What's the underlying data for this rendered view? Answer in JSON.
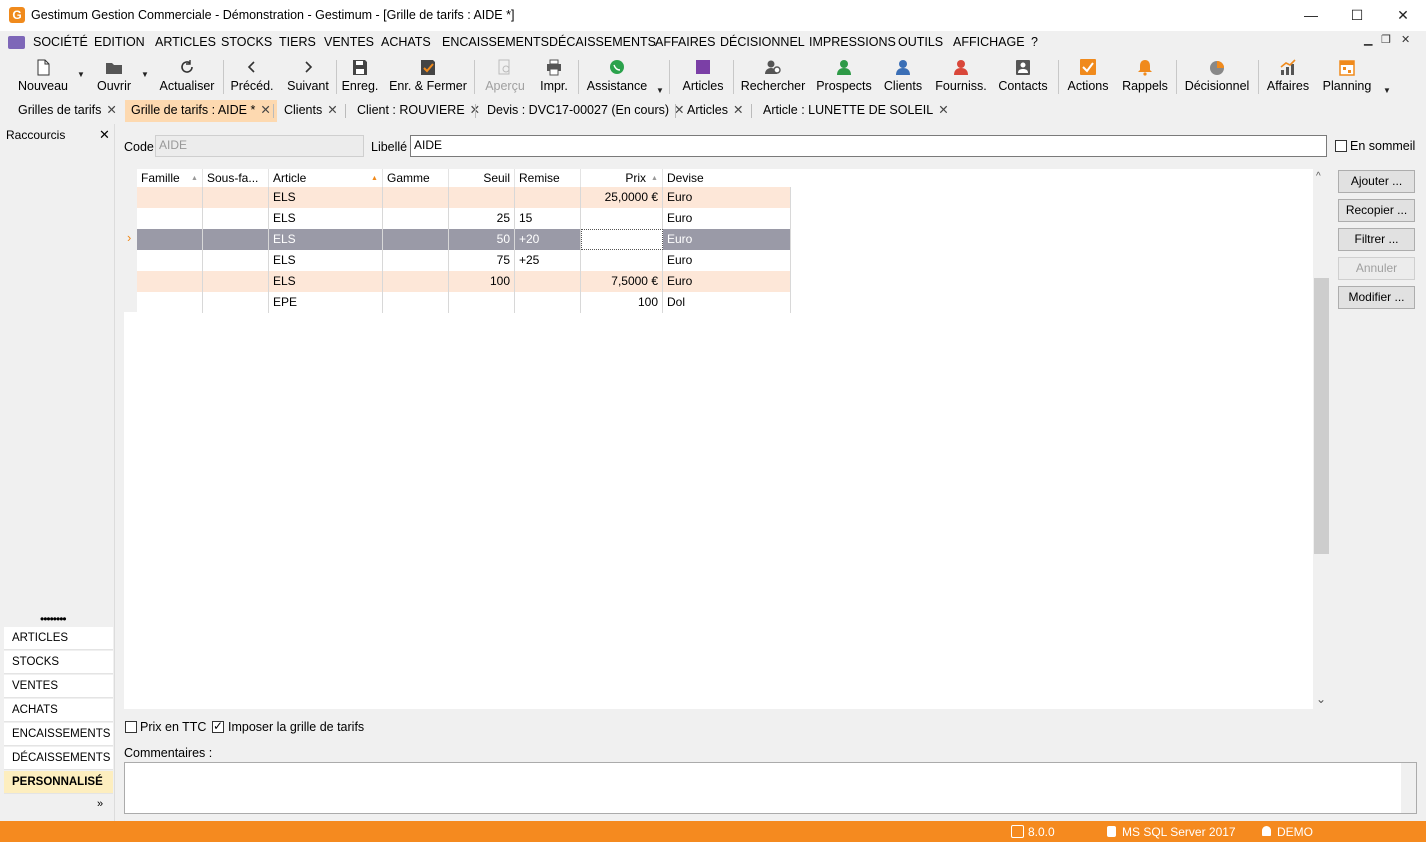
{
  "window": {
    "title": "Gestimum Gestion Commerciale - Démonstration - Gestimum - [Grille de tarifs : AIDE *]",
    "logo_letter": "G",
    "minimize": "—",
    "maximize": "☐",
    "close": "✕"
  },
  "menu": {
    "items": [
      "SOCIÉTÉ",
      "EDITION",
      "ARTICLES",
      "STOCKS",
      "TIERS",
      "VENTES",
      "ACHATS",
      "ENCAISSEMENTS",
      "DÉCAISSEMENTS",
      "AFFAIRES",
      "DÉCISIONNEL",
      "IMPRESSIONS",
      "OUTILS",
      "AFFICHAGE",
      "?"
    ],
    "mdi_minimize": "▁",
    "mdi_restore": "❐",
    "mdi_close": "✕"
  },
  "toolbar": {
    "nouveau": "Nouveau",
    "ouvrir": "Ouvrir",
    "actualiser": "Actualiser",
    "preced": "Précéd.",
    "suivant": "Suivant",
    "enreg": "Enreg.",
    "enr_fermer": "Enr. & Fermer",
    "apercu": "Aperçu",
    "impr": "Impr.",
    "assistance": "Assistance",
    "articles": "Articles",
    "rechercher": "Rechercher",
    "prospects": "Prospects",
    "clients": "Clients",
    "fourniss": "Fourniss.",
    "contacts": "Contacts",
    "actions": "Actions",
    "rappels": "Rappels",
    "decisionnel": "Décisionnel",
    "affaires": "Affaires",
    "planning": "Planning"
  },
  "tabs": [
    {
      "label": "Grilles de tarifs",
      "close": "✕"
    },
    {
      "label": "Grille de tarifs : AIDE *",
      "close": "✕"
    },
    {
      "label": "Clients",
      "close": "✕"
    },
    {
      "label": "Client : ROUVIERE",
      "close": "✕"
    },
    {
      "label": "Devis : DVC17-00027 (En cours)",
      "close": "✕"
    },
    {
      "label": "Articles",
      "close": "✕"
    },
    {
      "label": "Article : LUNETTE DE SOLEIL",
      "close": "✕"
    }
  ],
  "left_panel": {
    "title": "Raccourcis",
    "close": "✕",
    "grip": "••••••••",
    "items": [
      "ARTICLES",
      "STOCKS",
      "VENTES",
      "ACHATS",
      "ENCAISSEMENTS",
      "DÉCAISSEMENTS",
      "PERSONNALISÉ"
    ],
    "selected": "PERSONNALISÉ",
    "more": "»"
  },
  "form": {
    "code_label": "Code",
    "code_value": "AIDE",
    "libelle_label": "Libellé",
    "libelle_value": "AIDE",
    "en_sommeil_label": "En sommeil",
    "en_sommeil_checked": false
  },
  "grid": {
    "columns": [
      "Famille",
      "Sous-fa...",
      "Article",
      "Gamme",
      "Seuil",
      "Remise",
      "Prix",
      "Devise"
    ],
    "rows": [
      {
        "famille": "",
        "sousfa": "",
        "article": "ELS",
        "gamme": "",
        "seuil": "",
        "remise": "",
        "prix": "25,0000 €",
        "devise": "Euro",
        "style": "peach"
      },
      {
        "famille": "",
        "sousfa": "",
        "article": "ELS",
        "gamme": "",
        "seuil": "25",
        "remise": "15",
        "prix": "",
        "devise": "Euro",
        "style": "white"
      },
      {
        "famille": "",
        "sousfa": "",
        "article": "ELS",
        "gamme": "",
        "seuil": "50",
        "remise": "+20",
        "prix": "",
        "devise": "Euro",
        "style": "selected"
      },
      {
        "famille": "",
        "sousfa": "",
        "article": "ELS",
        "gamme": "",
        "seuil": "75",
        "remise": "+25",
        "prix": "",
        "devise": "Euro",
        "style": "white"
      },
      {
        "famille": "",
        "sousfa": "",
        "article": "ELS",
        "gamme": "",
        "seuil": "100",
        "remise": "",
        "prix": "7,5000 €",
        "devise": "Euro",
        "style": "peach"
      },
      {
        "famille": "",
        "sousfa": "",
        "article": "EPE",
        "gamme": "",
        "seuil": "",
        "remise": "",
        "prix": "100",
        "devise": "Dol",
        "style": "white"
      }
    ],
    "row_indicator": "›",
    "sort_asc": "▲",
    "sort_desc": "▲",
    "scroll_up": "^",
    "scroll_down": "⌄"
  },
  "side_buttons": {
    "ajouter": "Ajouter ...",
    "recopier": "Recopier ...",
    "filtrer": "Filtrer ...",
    "annuler": "Annuler",
    "modifier": "Modifier ..."
  },
  "bottom": {
    "prix_ttc_label": "Prix en TTC",
    "prix_ttc_checked": false,
    "imposer_label": "Imposer la grille de tarifs",
    "imposer_checked": true,
    "commentaires_label": "Commentaires :",
    "commentaires_value": ""
  },
  "status": {
    "version": "8.0.0",
    "server": "MS SQL Server 2017",
    "user": "DEMO"
  },
  "colors": {
    "accent": "#f58a1f",
    "row_peach": "#fde7d8",
    "row_selected": "#9a9aa7",
    "active_tab": "#fdd9b0"
  }
}
